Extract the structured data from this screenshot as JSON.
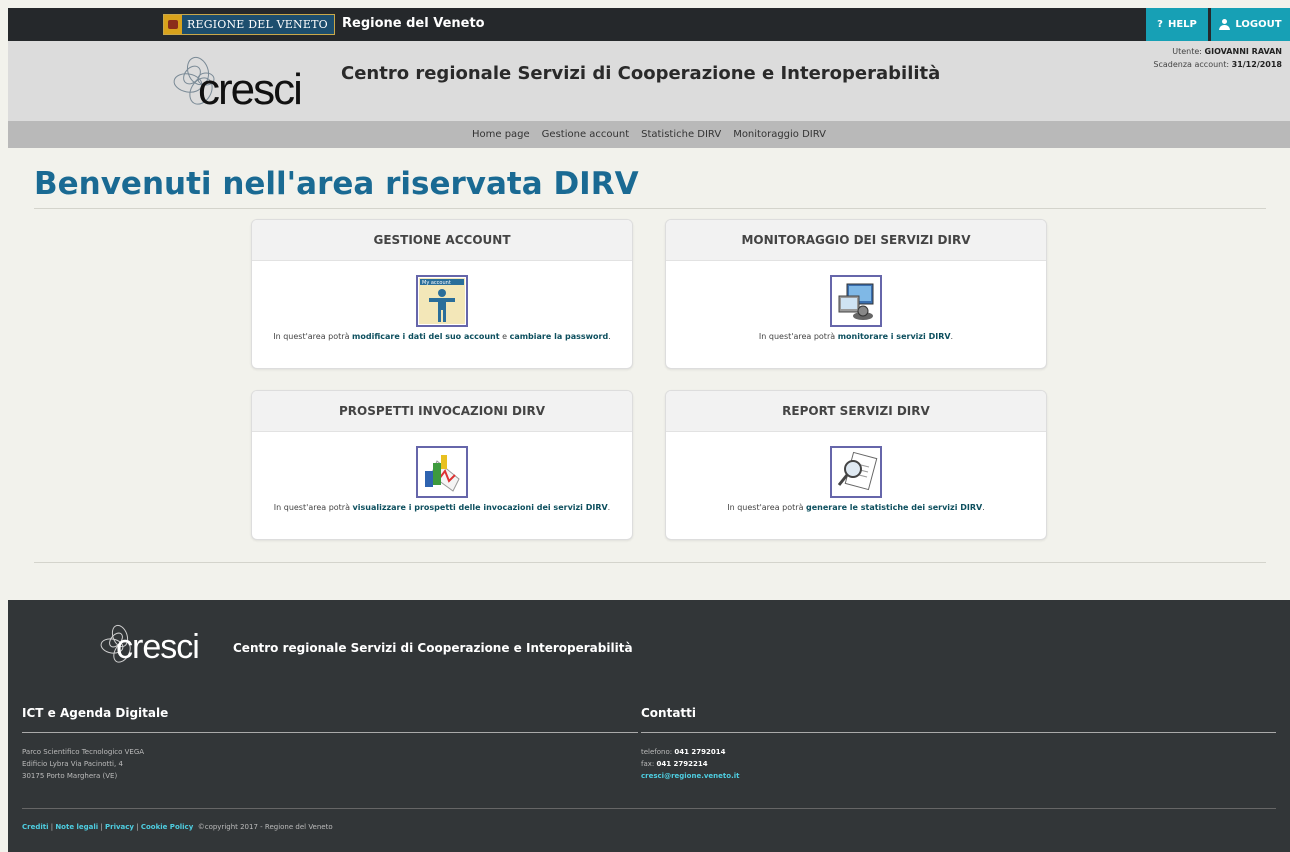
{
  "topbar": {
    "logo_text": "REGIONE DEL VENETO",
    "title": "Regione del Veneto",
    "help_label": "HELP",
    "logout_label": "LOGOUT"
  },
  "header": {
    "logo_text": "cresci",
    "title": "Centro regionale Servizi di Cooperazione e Interoperabilità",
    "user_prefix": "Utente:",
    "user_name": "GIOVANNI RAVAN",
    "expiry_prefix": "Scadenza account:",
    "expiry_date": "31/12/2018"
  },
  "nav": [
    {
      "label": "Home page"
    },
    {
      "label": "Gestione account"
    },
    {
      "label": "Statistiche DIRV"
    },
    {
      "label": "Monitoraggio DIRV"
    }
  ],
  "main": {
    "title": "Benvenuti nell'area riservata DIRV",
    "cards": [
      {
        "title": "GESTIONE ACCOUNT",
        "icon": "my-account-icon",
        "pre": "In quest'area potrà ",
        "b1": "modificare i dati del suo account",
        "mid": " e ",
        "b2": "cambiare la password",
        "post": "."
      },
      {
        "title": "MONITORAGGIO DEI SERVIZI DIRV",
        "icon": "monitor-icon",
        "pre": "In quest'area potrà ",
        "b1": "monitorare i servizi DIRV",
        "post": "."
      },
      {
        "title": "PROSPETTI INVOCAZIONI DIRV",
        "icon": "chart-icon",
        "pre": "In quest'area potrà ",
        "b1": "visualizzare i prospetti delle invocazioni dei servizi DIRV",
        "post": "."
      },
      {
        "title": "REPORT SERVIZI DIRV",
        "icon": "report-magnifier-icon",
        "pre": "In quest'area potrà ",
        "b1": "generare le statistiche dei servizi DIRV",
        "post": "."
      }
    ]
  },
  "footer": {
    "logo_text": "cresci",
    "title": "Centro regionale Servizi di Cooperazione e Interoperabilità",
    "left_heading": "ICT e Agenda Digitale",
    "address": [
      "Parco Scientifico Tecnologico VEGA",
      "Edificio Lybra Via Pacinotti, 4",
      "30175 Porto Marghera (VE)"
    ],
    "right_heading": "Contatti",
    "phone_prefix": "telefono:",
    "phone": "041 2792014",
    "fax_prefix": "fax:",
    "fax": "041 2792214",
    "email": "cresci@regione.veneto.it",
    "links": [
      "Crediti",
      "Note legali",
      "Privacy",
      "Cookie Policy"
    ],
    "copyright": "©copyright 2017 - Regione del Veneto"
  },
  "colors": {
    "accent": "#17a0b5",
    "title_blue": "#1a6a93",
    "topbar_bg": "#25282b",
    "footer_bg": "#323638"
  }
}
